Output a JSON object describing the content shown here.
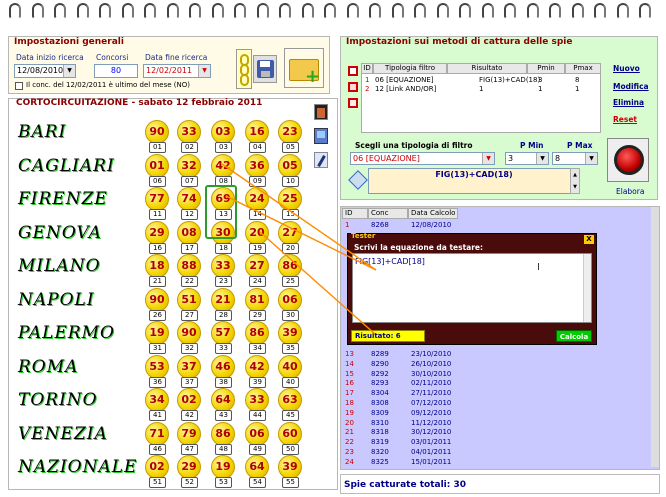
{
  "general": {
    "title": "Impostazioni generali",
    "start_label": "Data inizio ricerca",
    "start_value": "12/08/2010",
    "draws_label": "Concorsi",
    "draws_value": "80",
    "end_label": "Data fine ricerca",
    "end_value": "12/02/2011",
    "checkbox_label": "Il conc. del 12/02/2011 è ultimo del mese (NO)"
  },
  "draw": {
    "title": "CORTOCIRCUITAZIONE - sabato 12 febbraio 2011",
    "wheels": [
      {
        "name": "BARI",
        "nums": [
          "90",
          "33",
          "03",
          "16",
          "23"
        ],
        "pos": [
          "01",
          "02",
          "03",
          "04",
          "05"
        ]
      },
      {
        "name": "CAGLIARI",
        "nums": [
          "01",
          "32",
          "42",
          "36",
          "05"
        ],
        "pos": [
          "06",
          "07",
          "08",
          "09",
          "10"
        ]
      },
      {
        "name": "FIRENZE",
        "nums": [
          "77",
          "74",
          "69",
          "24",
          "25"
        ],
        "pos": [
          "11",
          "12",
          "13",
          "14",
          "15"
        ]
      },
      {
        "name": "GENOVA",
        "nums": [
          "29",
          "08",
          "30",
          "20",
          "27"
        ],
        "pos": [
          "16",
          "17",
          "18",
          "19",
          "20"
        ]
      },
      {
        "name": "MILANO",
        "nums": [
          "18",
          "88",
          "33",
          "27",
          "86"
        ],
        "pos": [
          "21",
          "22",
          "23",
          "24",
          "25"
        ]
      },
      {
        "name": "NAPOLI",
        "nums": [
          "90",
          "51",
          "21",
          "81",
          "06"
        ],
        "pos": [
          "26",
          "27",
          "28",
          "29",
          "30"
        ]
      },
      {
        "name": "PALERMO",
        "nums": [
          "19",
          "90",
          "57",
          "86",
          "39"
        ],
        "pos": [
          "31",
          "32",
          "33",
          "34",
          "35"
        ]
      },
      {
        "name": "ROMA",
        "nums": [
          "53",
          "37",
          "46",
          "42",
          "40"
        ],
        "pos": [
          "36",
          "37",
          "38",
          "39",
          "40"
        ]
      },
      {
        "name": "TORINO",
        "nums": [
          "34",
          "02",
          "64",
          "33",
          "63"
        ],
        "pos": [
          "41",
          "42",
          "43",
          "44",
          "45"
        ]
      },
      {
        "name": "VENEZIA",
        "nums": [
          "71",
          "79",
          "86",
          "06",
          "60"
        ],
        "pos": [
          "46",
          "47",
          "48",
          "49",
          "50"
        ]
      },
      {
        "name": "NAZIONALE",
        "nums": [
          "02",
          "29",
          "19",
          "64",
          "39"
        ],
        "pos": [
          "51",
          "52",
          "53",
          "54",
          "55"
        ]
      }
    ]
  },
  "methods": {
    "title": "Impostazioni sui metodi di cattura delle spie",
    "headers": [
      "ID",
      "Tipologia filtro",
      "Risultato",
      "Pmin",
      "Pmax"
    ],
    "rows": [
      {
        "id": "1",
        "tipo": "06 [EQUAZIONE]",
        "ris": "FIG(13)+CAD(18)",
        "pmin": "3",
        "pmax": "8"
      },
      {
        "id": "2",
        "tipo": "12 [Link AND/OR]",
        "ris": "1",
        "pmin": "1",
        "pmax": "1"
      }
    ],
    "links": [
      "Nuovo",
      "Modifica",
      "Elimina",
      "Reset"
    ],
    "filter_label": "Scegli una tipologia di filtro",
    "filter_value": "06 [EQUAZIONE]",
    "pmin_label": "P Min",
    "pmin_value": "3",
    "pmax_label": "P Max",
    "pmax_value": "8",
    "result_value": "FIG(13)+CAD(18)",
    "elabora_label": "Elabora"
  },
  "results": {
    "headers": [
      "ID",
      "Conc",
      "Data Calcolo"
    ],
    "top_rows": [
      [
        "1",
        "8268",
        "12/08/2010"
      ]
    ],
    "rows": [
      [
        "13",
        "8289",
        "23/10/2010"
      ],
      [
        "14",
        "8290",
        "26/10/2010"
      ],
      [
        "15",
        "8292",
        "30/10/2010"
      ],
      [
        "16",
        "8293",
        "02/11/2010"
      ],
      [
        "17",
        "8304",
        "27/11/2010"
      ],
      [
        "18",
        "8308",
        "07/12/2010"
      ],
      [
        "19",
        "8309",
        "09/12/2010"
      ],
      [
        "20",
        "8310",
        "11/12/2010"
      ],
      [
        "21",
        "8318",
        "30/12/2010"
      ],
      [
        "22",
        "8319",
        "03/01/2011"
      ],
      [
        "23",
        "8320",
        "04/01/2011"
      ],
      [
        "24",
        "8325",
        "15/01/2011"
      ]
    ],
    "total_label": "Spie catturate totali: 30"
  },
  "tester": {
    "title": "Tester",
    "close": "X",
    "prompt": "Scrivi la equazione da testare:",
    "equation": "FIG[13]+CAD[18]",
    "result": "Risultato: 6",
    "calc_label": "Calcola"
  }
}
